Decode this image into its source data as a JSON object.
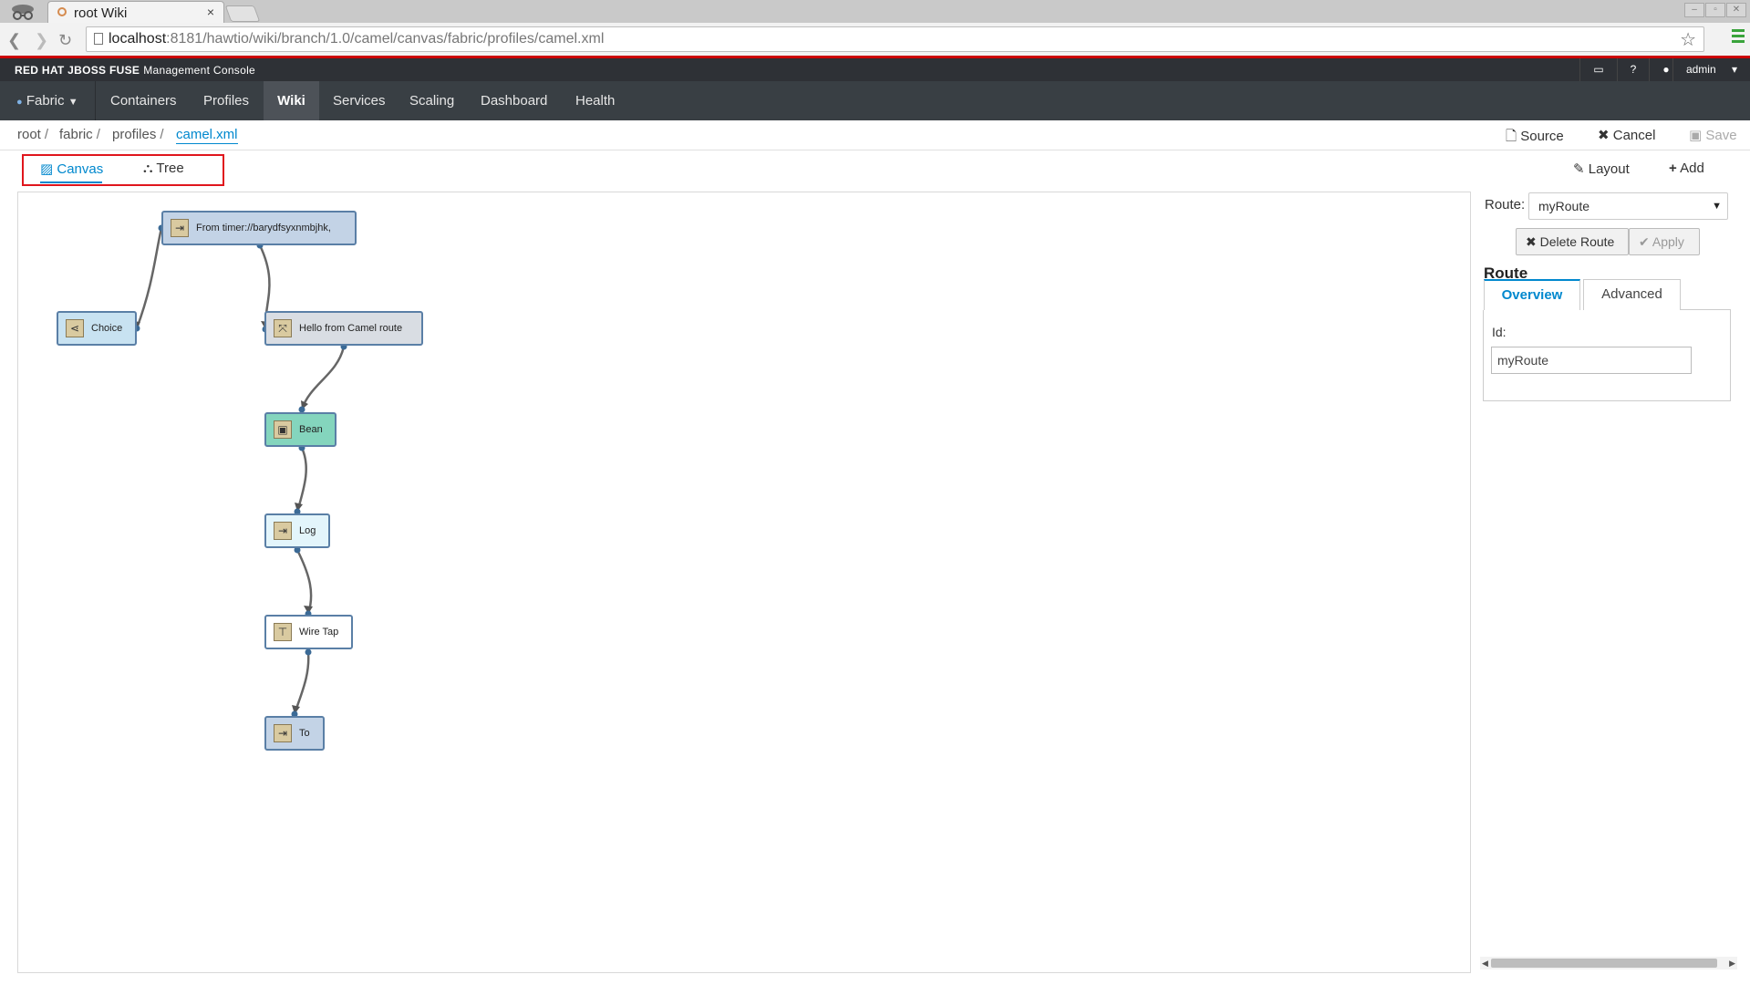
{
  "browser": {
    "tab_title": "root Wiki",
    "tab_close": "×",
    "url_host": "localhost",
    "url_rest": ":8181/hawtio/wiki/branch/1.0/camel/canvas/fabric/profiles/camel.xml"
  },
  "header": {
    "brand": "RED HAT JBOSS FUSE",
    "brand_sub": "Management Console",
    "user": "admin"
  },
  "nav": {
    "fabric": "Fabric",
    "items": [
      "Containers",
      "Profiles",
      "Wiki",
      "Services",
      "Scaling",
      "Dashboard",
      "Health"
    ],
    "active": "Wiki"
  },
  "breadcrumbs": {
    "items": [
      "root",
      "fabric",
      "profiles",
      "camel.xml"
    ],
    "sep": "/"
  },
  "actions": {
    "source": "Source",
    "cancel": "Cancel",
    "save": "Save",
    "layout": "Layout",
    "add": "Add"
  },
  "view_tabs": {
    "canvas": "Canvas",
    "tree": "Tree"
  },
  "diagram": {
    "nodes": [
      {
        "label": "From timer://barydfsyxnmbjhk,"
      },
      {
        "label": "Choice"
      },
      {
        "label": "Hello from Camel route"
      },
      {
        "label": "Bean"
      },
      {
        "label": "Log"
      },
      {
        "label": "Wire Tap"
      },
      {
        "label": "To"
      }
    ]
  },
  "panel": {
    "route_label": "Route:",
    "route_value": "myRoute",
    "delete_route": "Delete Route",
    "apply": "Apply",
    "title": "Route",
    "tab_overview": "Overview",
    "tab_advanced": "Advanced",
    "id_label": "Id:",
    "id_value": "myRoute"
  },
  "colors": {
    "accent": "#0088ce",
    "highlight": "#e0161d",
    "nav_bg": "#393f44",
    "brand_bg": "#2e3136"
  }
}
